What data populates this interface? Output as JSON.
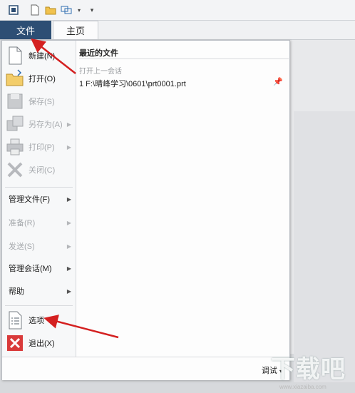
{
  "tabs": {
    "file": "文件",
    "home": "主页"
  },
  "menu": {
    "new": "新建(N)",
    "open": "打开(O)",
    "save": "保存(S)",
    "save_as": "另存为(A)",
    "print": "打印(P)",
    "close": "关闭(C)",
    "manage_file": "管理文件(F)",
    "prepare": "准备(R)",
    "send": "发送(S)",
    "manage_session": "管理会话(M)",
    "help": "帮助",
    "options": "选项",
    "exit": "退出(X)"
  },
  "recent": {
    "title": "最近的文件",
    "open_last_session": "打开上一会话",
    "file1": "1  F:\\晴峰学习\\0601\\prt0001.prt"
  },
  "bottom": {
    "debug": "调试"
  },
  "watermark": {
    "main": "下载吧",
    "url": "www.xiazaiba.com"
  },
  "colors": {
    "file_tab": "#2d4e74",
    "annotation_arrow": "#d42020",
    "exit_icon": "#d93a3a"
  }
}
